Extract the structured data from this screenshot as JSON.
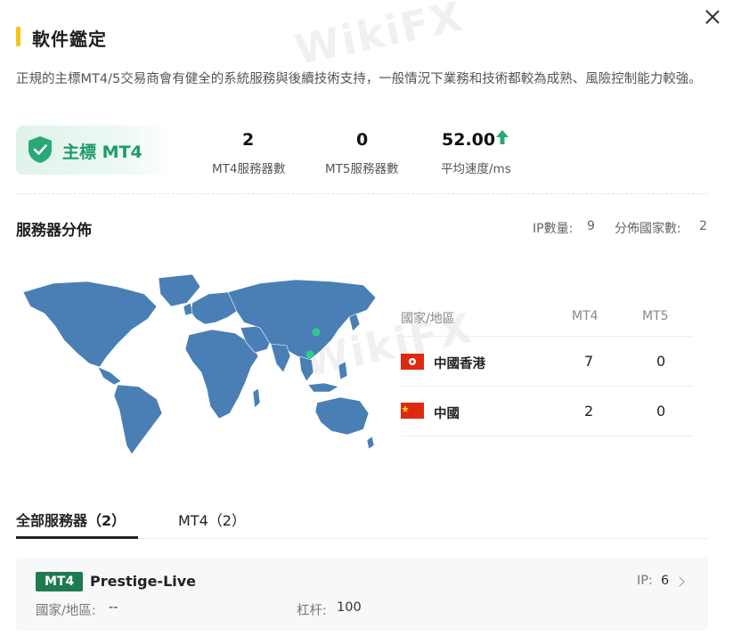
{
  "header": {
    "title": "軟件鑑定",
    "description": "正規的主標MT4/5交易商會有健全的系統服務與後續技術支持，一般情況下業務和技術都較為成熟、風險控制能力較強。"
  },
  "badge": {
    "label": "主標 MT4",
    "icon": "shield-check-icon",
    "color": "#1e9b6a"
  },
  "stats": [
    {
      "value": "2",
      "label": "MT4服務器數"
    },
    {
      "value": "0",
      "label": "MT5服務器數"
    },
    {
      "value": "52.00",
      "label": "平均速度/ms",
      "trend_icon": "arrow-up-icon"
    }
  ],
  "distribution": {
    "title": "服務器分佈",
    "ip_label": "IP數量:",
    "ip_count": "9",
    "country_label": "分佈國家數:",
    "country_count": "2",
    "columns": [
      "國家/地區",
      "MT4",
      "MT5"
    ],
    "rows": [
      {
        "flag": "hong-kong-flag",
        "country": "中國香港",
        "mt4": "7",
        "mt5": "0"
      },
      {
        "flag": "china-flag",
        "country": "中國",
        "mt4": "2",
        "mt5": "0"
      }
    ]
  },
  "tabs": [
    {
      "label": "全部服務器（2）",
      "active": true
    },
    {
      "label": "MT4（2）",
      "active": false
    }
  ],
  "server": {
    "platform": "MT4",
    "name": "Prestige-Live",
    "ip_label": "IP:",
    "ip_value": "6",
    "region_label": "國家/地區:",
    "region_value": "--",
    "leverage_label": "杠杆:",
    "leverage_value": "100"
  },
  "watermark": "WikiFX",
  "colors": {
    "accent_yellow": "#f5c518",
    "accent_green": "#1e9b6a",
    "map_blue": "#4a7fb5",
    "tag_green": "#1e7a4f"
  }
}
